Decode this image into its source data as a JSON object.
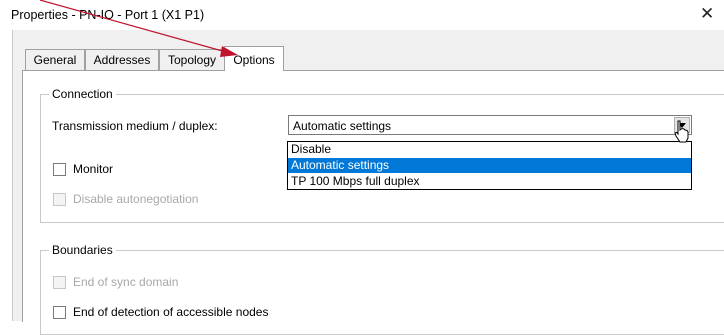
{
  "window": {
    "title": "Properties - PN-IO - Port 1 (X1 P1)",
    "close_glyph": "✕"
  },
  "tabs": [
    {
      "label": "General",
      "active": false
    },
    {
      "label": "Addresses",
      "active": false
    },
    {
      "label": "Topology",
      "active": false
    },
    {
      "label": "Options",
      "active": true
    }
  ],
  "connection": {
    "group_label": "Connection",
    "medium_label": "Transmission medium / duplex:",
    "medium_value": "Automatic settings",
    "medium_options": [
      {
        "label": "Disable",
        "selected": false
      },
      {
        "label": "Automatic settings",
        "selected": true
      },
      {
        "label": "TP 100 Mbps full duplex",
        "selected": false
      }
    ],
    "monitor_label": "Monitor",
    "monitor_checked": false,
    "autoneg_label": "Disable autonegotiation",
    "autoneg_checked": false,
    "autoneg_enabled": false
  },
  "boundaries": {
    "group_label": "Boundaries",
    "sync_label": "End of sync domain",
    "sync_checked": false,
    "sync_enabled": false,
    "detection_label": "End of detection of accessible nodes",
    "detection_checked": false,
    "detection_enabled": true
  },
  "colors": {
    "highlight": "#0078d7",
    "annotation_arrow": "#c0142c"
  },
  "icons": {
    "combo_button": "chevron-down-icon",
    "cursor": "mouse-pointer-icon",
    "annotation": "red-arrow-icon"
  }
}
